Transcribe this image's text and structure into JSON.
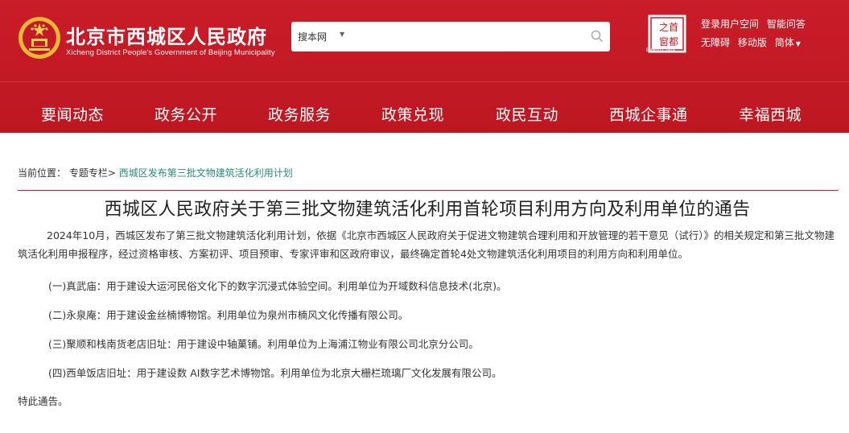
{
  "header": {
    "site_title": "北京市西城区人民政府",
    "site_subtitle": "Xicheng District People's Government of Beijing Municipality",
    "search": {
      "scope": "搜本网",
      "placeholder": ""
    },
    "capital_logo_caption": "Beijing·China",
    "links_row1": [
      "登录用户空间",
      "智能问答"
    ],
    "links_row2": [
      "无障碍",
      "移动版",
      "简体"
    ],
    "icons": {
      "emblem": "national-emblem-icon",
      "search": "search-icon",
      "logo": "capital-beijing-logo-icon"
    },
    "colors": {
      "header_bg": "#c41a26",
      "accent_link": "#2a8a7b"
    }
  },
  "nav": [
    "要闻动态",
    "政务公开",
    "政务服务",
    "政策兑现",
    "政民互动",
    "西城企事通",
    "幸福西城"
  ],
  "breadcrumb": {
    "label": "当前位置：",
    "items": [
      "专题专栏>",
      "西城区发布第三批文物建筑活化利用计划"
    ]
  },
  "article": {
    "title": "西城区人民政府关于第三批文物建筑活化利用首轮项目利用方向及利用单位的通告",
    "intro": "2024年10月，西城区发布了第三批文物建筑活化利用计划，依据《北京市西城区人民政府关于促进文物建筑合理利用和开放管理的若干意见（试行）》的相关规定和第三批文物建筑活化利用申报程序，经过资格审核、方案初评、项目预审、专家评审和区政府审议，最终确定首轮4处文物建筑活化利用项目的利用方向和利用单位。",
    "items": [
      "(一)真武庙：用于建设大运河民俗文化下的数字沉浸式体验空间。利用单位为开域数科信息技术(北京)。",
      "(二)永泉庵：用于建设金丝楠博物馆。利用单位为泉州市楠风文化传播有限公司。",
      "(三)聚顺和栈南货老店旧址：用于建设中轴菓铺。利用单位为上海浦江物业有限公司北京分公司。",
      "(四)西单饭店旧址：用于建设数 AI数字艺术博物馆。利用单位为北京大栅栏琉璃厂文化发展有限公司。"
    ],
    "closing": "特此通告。"
  }
}
